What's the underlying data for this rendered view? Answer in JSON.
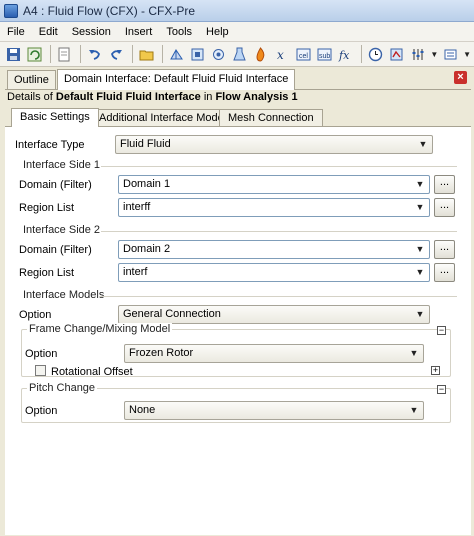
{
  "window": {
    "title": "A4 : Fluid Flow (CFX) - CFX-Pre"
  },
  "menu": [
    "File",
    "Edit",
    "Session",
    "Insert",
    "Tools",
    "Help"
  ],
  "tabs": {
    "outline": "Outline",
    "active": "Domain Interface: Default Fluid Fluid Interface"
  },
  "details": {
    "prefix": "Details of ",
    "object": "Default Fluid Fluid Interface",
    "in": " in ",
    "analysis": "Flow Analysis 1"
  },
  "subtabs": [
    "Basic Settings",
    "Additional Interface Models",
    "Mesh Connection"
  ],
  "basic": {
    "interface_type_label": "Interface Type",
    "interface_type_value": "Fluid Fluid",
    "side1": {
      "title": "Interface Side 1",
      "domain_label": "Domain (Filter)",
      "domain_value": "Domain 1",
      "region_label": "Region List",
      "region_value": "interff"
    },
    "side2": {
      "title": "Interface Side 2",
      "domain_label": "Domain (Filter)",
      "domain_value": "Domain 2",
      "region_label": "Region List",
      "region_value": "interf"
    },
    "models": {
      "title": "Interface Models",
      "option_label": "Option",
      "option_value": "General Connection"
    },
    "frame": {
      "title": "Frame Change/Mixing Model",
      "option_label": "Option",
      "option_value": "Frozen Rotor",
      "rotational_offset_label": "Rotational Offset"
    },
    "pitch": {
      "title": "Pitch Change",
      "option_label": "Option",
      "option_value": "None"
    }
  },
  "browse_label": "...",
  "toggle_minus": "−",
  "toggle_plus": "+",
  "close_label": "×",
  "arrow": "▼"
}
